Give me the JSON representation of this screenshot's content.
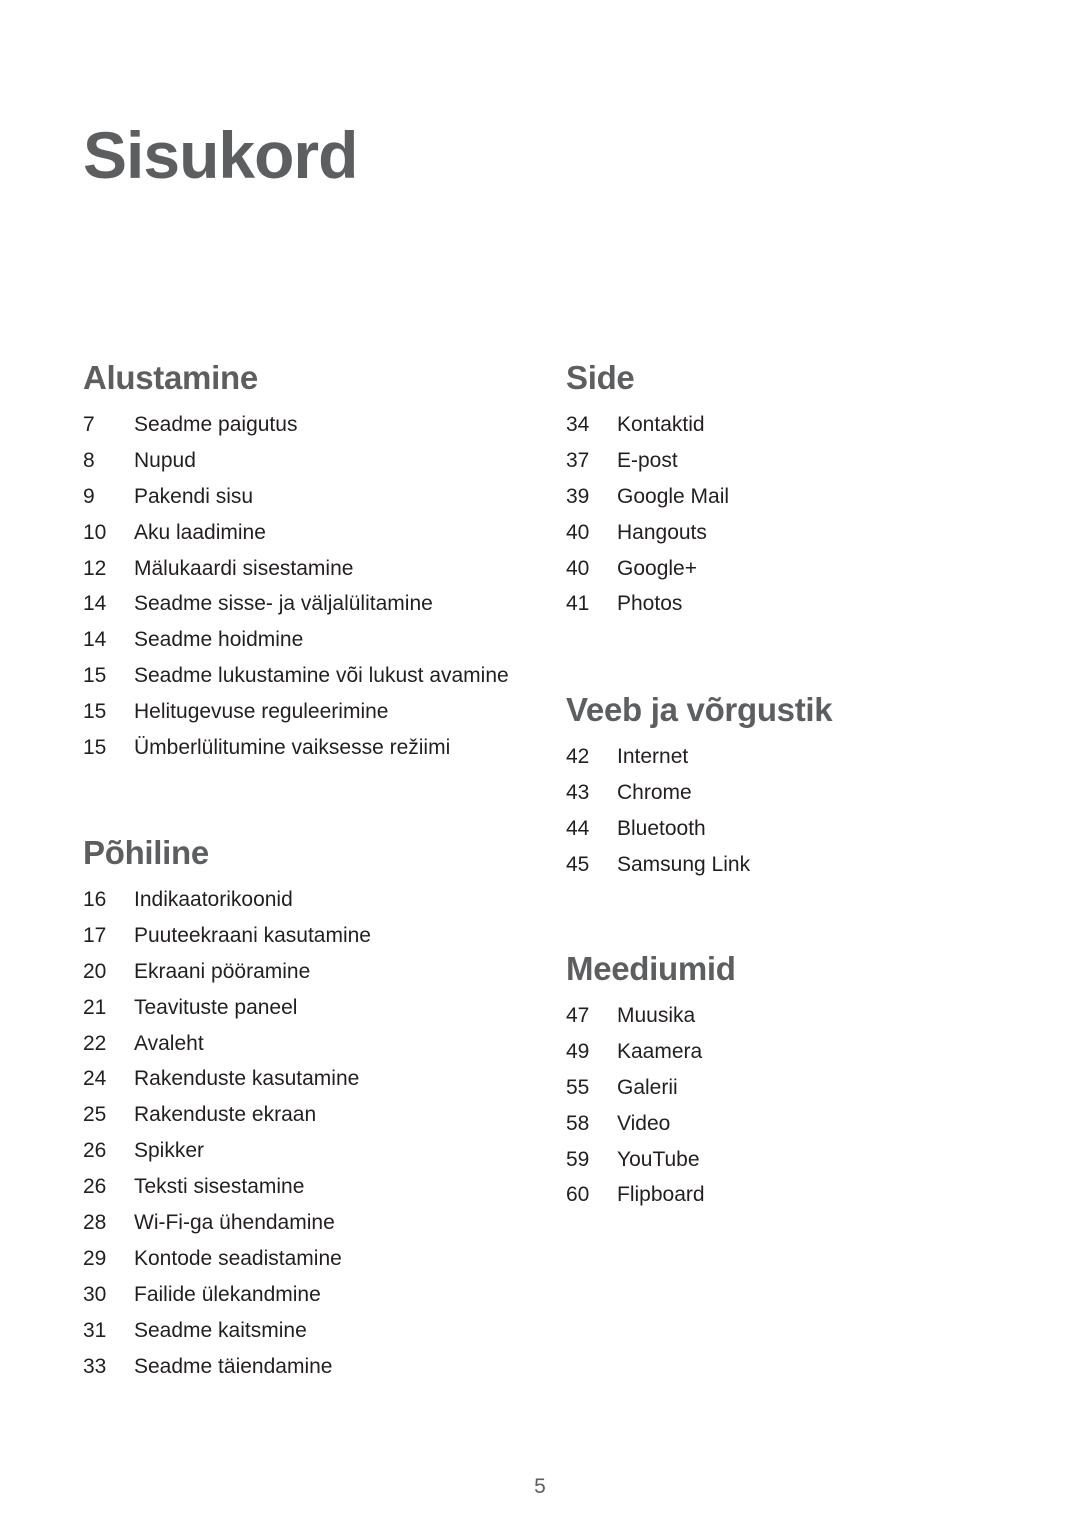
{
  "page_title": "Sisukord",
  "page_number": "5",
  "sections": [
    {
      "title": "Alustamine",
      "items": [
        {
          "page": "7",
          "label": "Seadme paigutus"
        },
        {
          "page": "8",
          "label": "Nupud"
        },
        {
          "page": "9",
          "label": "Pakendi sisu"
        },
        {
          "page": "10",
          "label": "Aku laadimine"
        },
        {
          "page": "12",
          "label": "Mälukaardi sisestamine"
        },
        {
          "page": "14",
          "label": "Seadme sisse- ja väljalülitamine"
        },
        {
          "page": "14",
          "label": "Seadme hoidmine"
        },
        {
          "page": "15",
          "label": "Seadme lukustamine või lukust avamine"
        },
        {
          "page": "15",
          "label": "Helitugevuse reguleerimine"
        },
        {
          "page": "15",
          "label": "Ümberlülitumine vaiksesse režiimi"
        }
      ]
    },
    {
      "title": "Põhiline",
      "items": [
        {
          "page": "16",
          "label": "Indikaatorikoonid"
        },
        {
          "page": "17",
          "label": "Puuteekraani kasutamine"
        },
        {
          "page": "20",
          "label": "Ekraani pööramine"
        },
        {
          "page": "21",
          "label": "Teavituste paneel"
        },
        {
          "page": "22",
          "label": "Avaleht"
        },
        {
          "page": "24",
          "label": "Rakenduste kasutamine"
        },
        {
          "page": "25",
          "label": "Rakenduste ekraan"
        },
        {
          "page": "26",
          "label": "Spikker"
        },
        {
          "page": "26",
          "label": "Teksti sisestamine"
        },
        {
          "page": "28",
          "label": "Wi-Fi-ga ühendamine"
        },
        {
          "page": "29",
          "label": "Kontode seadistamine"
        },
        {
          "page": "30",
          "label": "Failide ülekandmine"
        },
        {
          "page": "31",
          "label": "Seadme kaitsmine"
        },
        {
          "page": "33",
          "label": "Seadme täiendamine"
        }
      ]
    },
    {
      "title": "Side",
      "items": [
        {
          "page": "34",
          "label": "Kontaktid"
        },
        {
          "page": "37",
          "label": "E-post"
        },
        {
          "page": "39",
          "label": "Google Mail"
        },
        {
          "page": "40",
          "label": "Hangouts"
        },
        {
          "page": "40",
          "label": "Google+"
        },
        {
          "page": "41",
          "label": "Photos"
        }
      ]
    },
    {
      "title": "Veeb ja võrgustik",
      "items": [
        {
          "page": "42",
          "label": "Internet"
        },
        {
          "page": "43",
          "label": "Chrome"
        },
        {
          "page": "44",
          "label": "Bluetooth"
        },
        {
          "page": "45",
          "label": "Samsung Link"
        }
      ]
    },
    {
      "title": "Meediumid",
      "items": [
        {
          "page": "47",
          "label": "Muusika"
        },
        {
          "page": "49",
          "label": "Kaamera"
        },
        {
          "page": "55",
          "label": "Galerii"
        },
        {
          "page": "58",
          "label": "Video"
        },
        {
          "page": "59",
          "label": "YouTube"
        },
        {
          "page": "60",
          "label": "Flipboard"
        }
      ]
    }
  ]
}
